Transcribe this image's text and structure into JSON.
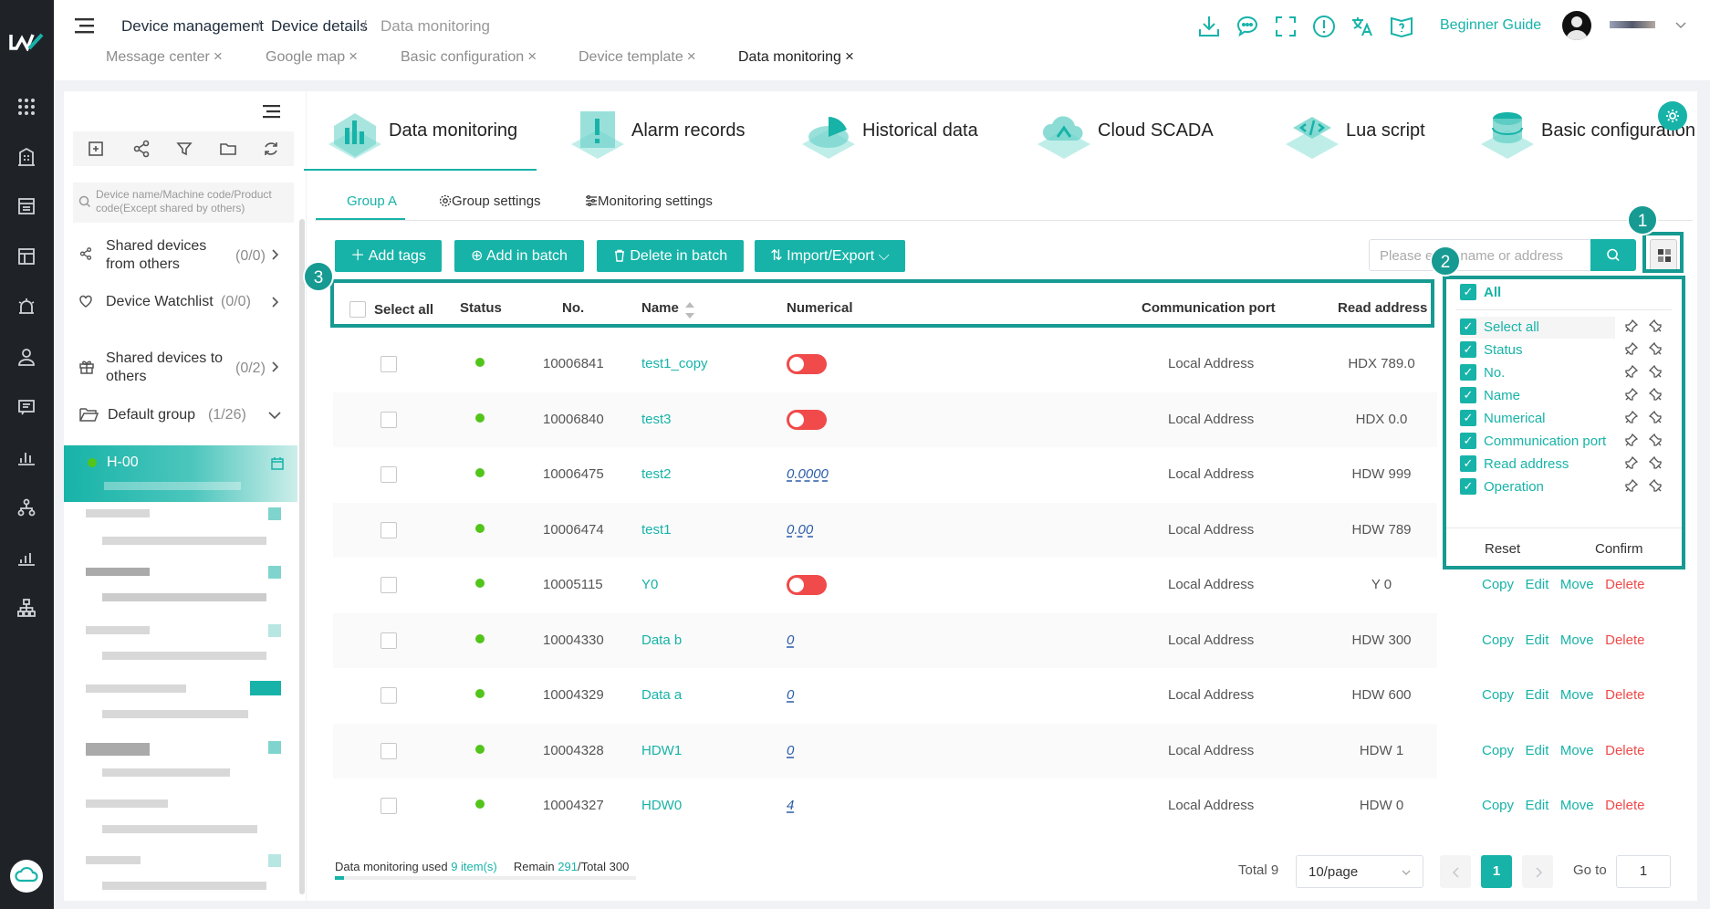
{
  "breadcrumb": {
    "root": "Device management",
    "sep": "/",
    "parent": "Device details",
    "current": "Data monitoring"
  },
  "tabs": [
    {
      "label": "Message center",
      "close": "×"
    },
    {
      "label": "Google map",
      "close": "×"
    },
    {
      "label": "Basic configuration",
      "close": "×"
    },
    {
      "label": "Device template",
      "close": "×"
    },
    {
      "label": "Data monitoring",
      "close": "×"
    }
  ],
  "header": {
    "guide": "Beginner Guide"
  },
  "sidebar": {
    "search_placeholder": "Device name/Machine code/Product code(Except shared by others)",
    "shared_from": {
      "label": "Shared devices from others",
      "count": "(0/0)"
    },
    "watchlist": {
      "label": "Device Watchlist",
      "count": "(0/0)"
    },
    "shared_to": {
      "label": "Shared devices to others",
      "count": "(0/2)"
    },
    "default_group": {
      "label": "Default group",
      "count": "(1/26)"
    },
    "active_device": "H-00"
  },
  "modules": [
    {
      "label": "Data monitoring"
    },
    {
      "label": "Alarm records"
    },
    {
      "label": "Historical data"
    },
    {
      "label": "Cloud SCADA"
    },
    {
      "label": "Lua script"
    },
    {
      "label": "Basic configuration"
    }
  ],
  "subtabs": {
    "group": "Group A",
    "group_settings": "Group settings",
    "monitoring_settings": "Monitoring settings"
  },
  "toolbar": {
    "add_tags": "Add tags",
    "add_batch": "Add in batch",
    "delete_batch": "Delete in batch",
    "import_export": "Import/Export",
    "search_placeholder": "Please enter name or address"
  },
  "table": {
    "headers": {
      "select_all": "Select all",
      "status": "Status",
      "no": "No.",
      "name": "Name",
      "numerical": "Numerical",
      "port": "Communication port",
      "address": "Read address"
    },
    "rows": [
      {
        "no": "10006841",
        "name": "test1_copy",
        "kind": "switch",
        "value": "",
        "port": "Local Address",
        "address": "HDX 789.0"
      },
      {
        "no": "10006840",
        "name": "test3",
        "kind": "switch",
        "value": "",
        "port": "Local Address",
        "address": "HDX 0.0"
      },
      {
        "no": "10006475",
        "name": "test2",
        "kind": "number",
        "value": "0.0000",
        "port": "Local Address",
        "address": "HDW 999"
      },
      {
        "no": "10006474",
        "name": "test1",
        "kind": "number",
        "value": "0.00",
        "port": "Local Address",
        "address": "HDW 789"
      },
      {
        "no": "10005115",
        "name": "Y0",
        "kind": "switch",
        "value": "",
        "port": "Local Address",
        "address": "Y 0"
      },
      {
        "no": "10004330",
        "name": "Data b",
        "kind": "number",
        "value": "0",
        "port": "Local Address",
        "address": "HDW 300"
      },
      {
        "no": "10004329",
        "name": "Data a",
        "kind": "number",
        "value": "0",
        "port": "Local Address",
        "address": "HDW 600"
      },
      {
        "no": "10004328",
        "name": "HDW1",
        "kind": "number",
        "value": "0",
        "port": "Local Address",
        "address": "HDW 1"
      },
      {
        "no": "10004327",
        "name": "HDW0",
        "kind": "number",
        "value": "4",
        "port": "Local Address",
        "address": "HDW 0"
      }
    ],
    "ops": {
      "copy": "Copy",
      "edit": "Edit",
      "move": "Move",
      "delete": "Delete"
    }
  },
  "column_panel": {
    "all": "All",
    "items": [
      "Select all",
      "Status",
      "No.",
      "Name",
      "Numerical",
      "Communication port",
      "Read address",
      "Operation"
    ],
    "reset": "Reset",
    "confirm": "Confirm"
  },
  "annotations": [
    "1",
    "2",
    "3"
  ],
  "footer": {
    "used_label": "Data monitoring used",
    "used_value": "9 item(s)",
    "remain_label": "Remain",
    "remain_value": "291",
    "total_label": "/Total 300",
    "usage_fraction": 0.03
  },
  "pagination": {
    "total": "Total 9",
    "per_page": "10/page",
    "current": "1",
    "goto_label": "Go to",
    "goto_value": "1"
  },
  "colors": {
    "accent": "#17b3a8",
    "danger": "#f04a4a",
    "nav": "#1f2328",
    "online": "#52c41a"
  }
}
